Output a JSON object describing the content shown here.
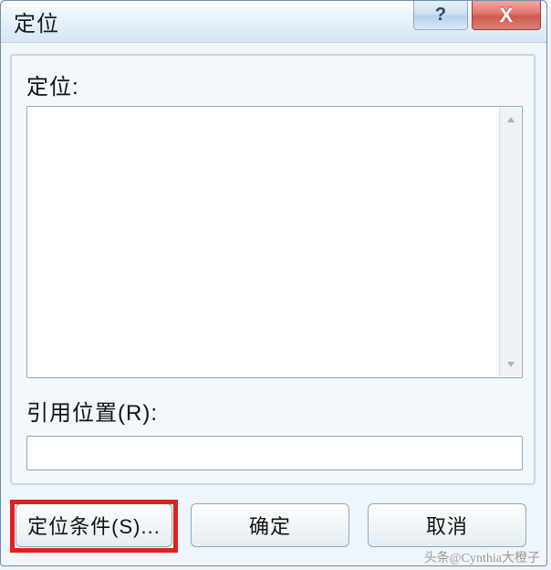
{
  "titlebar": {
    "title": "定位",
    "help_symbol": "?",
    "close_symbol": "X"
  },
  "panel": {
    "goto_label": "定位:",
    "reference_label": "引用位置(R):",
    "reference_value": ""
  },
  "buttons": {
    "special": "定位条件(S)...",
    "ok": "确定",
    "cancel": "取消"
  },
  "watermark": "头条@Cynthia大橙子"
}
